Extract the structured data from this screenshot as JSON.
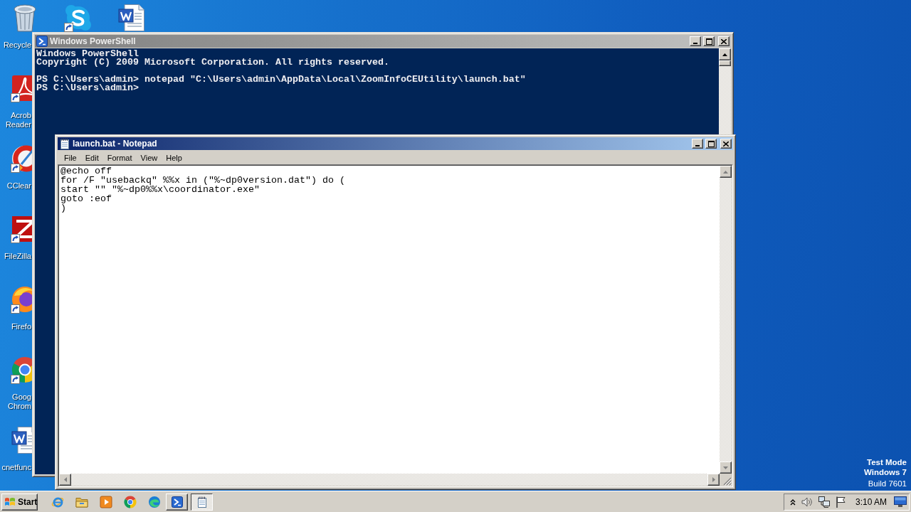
{
  "desktop": {
    "icon_columns": [
      [
        {
          "kind": "trash",
          "shortcut": false,
          "label": [
            "Recycle"
          ]
        },
        {
          "kind": "pdf",
          "shortcut": true,
          "label": [
            "Acrob",
            "Reader"
          ]
        },
        {
          "kind": "cleaner",
          "shortcut": true,
          "label": [
            "CClear"
          ]
        },
        {
          "kind": "ftp",
          "shortcut": true,
          "label": [
            "FileZilla"
          ]
        },
        {
          "kind": "firefox",
          "shortcut": true,
          "label": [
            "Firefo"
          ]
        },
        {
          "kind": "chrome",
          "shortcut": true,
          "label": [
            "Goog",
            "Chrom"
          ]
        },
        {
          "kind": "word",
          "shortcut": false,
          "label": [
            "cnetfunc"
          ]
        }
      ],
      [
        {
          "kind": "skype",
          "shortcut": true
        }
      ],
      [
        {
          "kind": "word",
          "shortcut": false
        }
      ]
    ],
    "os_notice": {
      "mode": "Test Mode",
      "edition": "Windows 7",
      "build": "Build 7601"
    }
  },
  "windows": [
    {
      "kind": "console",
      "title": "Windows PowerShell",
      "active": false,
      "vertical_scrollbar": {
        "disabled": false
      },
      "output_blocks": [
        [
          "Windows PowerShell",
          "Copyright (C) 2009 Microsoft Corporation. All rights reserved."
        ],
        [
          "PS C:\\Users\\admin> notepad \"C:\\Users\\admin\\AppData\\Local\\ZoomInfoCEUtility\\launch.bat\"",
          "PS C:\\Users\\admin>"
        ]
      ]
    },
    {
      "kind": "notepad",
      "title": "launch.bat - Notepad",
      "active": true,
      "menu": [
        "File",
        "Edit",
        "Format",
        "View",
        "Help"
      ],
      "vertical_scrollbar": {
        "disabled": true
      },
      "horizontal_scrollbar": {
        "disabled": true
      },
      "text_lines": [
        "@echo off",
        "for /F \"usebackq\" %%x in (\"%~dp0version.dat\") do (",
        "start \"\" \"%~dp0%%x\\coordinator.exe\"",
        "goto :eof",
        ")"
      ]
    }
  ],
  "taskbar": {
    "start_label": "Start",
    "quick_launch": [
      {
        "kind": "ie"
      },
      {
        "kind": "folder"
      },
      {
        "kind": "media"
      },
      {
        "kind": "chrome"
      },
      {
        "kind": "edge"
      }
    ],
    "tasks": [
      {
        "kind": "console",
        "selected": false
      },
      {
        "kind": "notepad",
        "selected": true
      }
    ],
    "tray": {
      "icons": [
        {
          "kind": "chevron"
        },
        {
          "kind": "speaker"
        },
        {
          "kind": "network"
        },
        {
          "kind": "flag"
        }
      ],
      "clock": "3:10 AM"
    }
  }
}
